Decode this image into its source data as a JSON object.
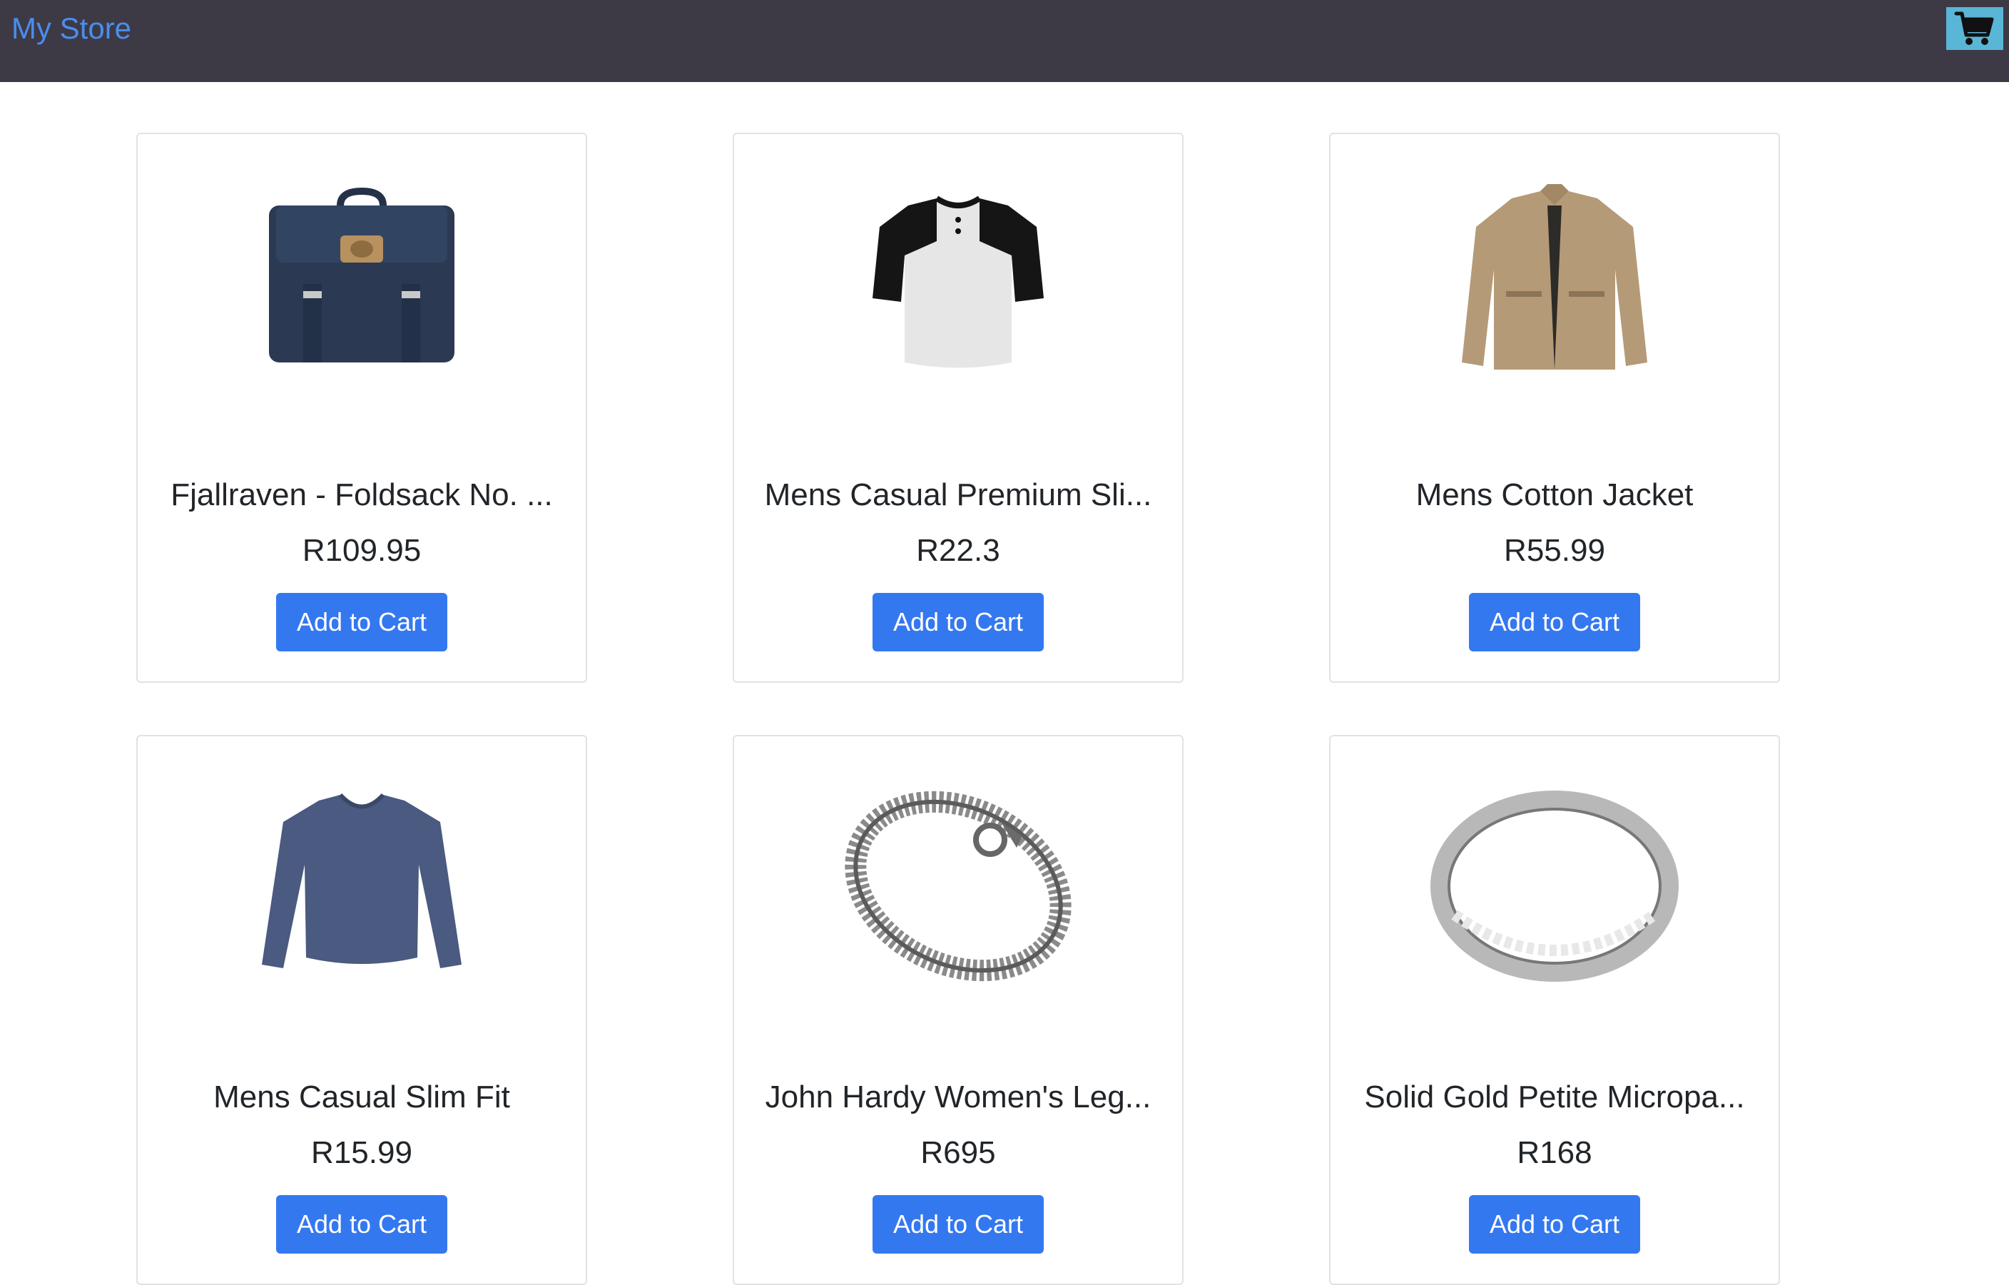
{
  "navbar": {
    "brand": "My Store",
    "cart_icon": "shopping-cart-icon",
    "cart_bg": "#5ab6d6",
    "bg": "#3d3a46"
  },
  "colors": {
    "brand_link": "#4a8dee",
    "button": "#3478f0",
    "card_border": "#e2e2e2"
  },
  "products": [
    {
      "title": "Fjallraven - Foldsack No. ...",
      "price": "R109.95",
      "button_label": "Add to Cart",
      "image_icon": "backpack-icon"
    },
    {
      "title": "Mens Casual Premium Sli...",
      "price": "R22.3",
      "button_label": "Add to Cart",
      "image_icon": "tshirt-icon"
    },
    {
      "title": "Mens Cotton Jacket",
      "price": "R55.99",
      "button_label": "Add to Cart",
      "image_icon": "jacket-icon"
    },
    {
      "title": "Mens Casual Slim Fit",
      "price": "R15.99",
      "button_label": "Add to Cart",
      "image_icon": "long-sleeve-shirt-icon"
    },
    {
      "title": "John Hardy Women's Leg...",
      "price": "R695",
      "button_label": "Add to Cart",
      "image_icon": "bracelet-icon"
    },
    {
      "title": "Solid Gold Petite Micropa...",
      "price": "R168",
      "button_label": "Add to Cart",
      "image_icon": "ring-icon"
    }
  ]
}
